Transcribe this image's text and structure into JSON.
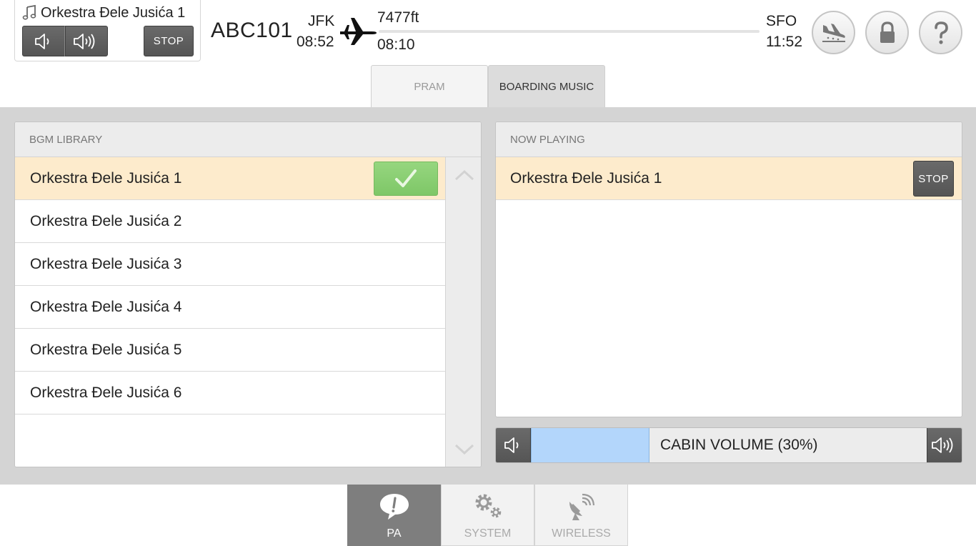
{
  "now_playing_widget": {
    "track": "Orkestra Đele Jusića 1",
    "music_icon": "music-note-icon",
    "vol_down_icon": "speaker-low-icon",
    "vol_up_icon": "speaker-high-icon",
    "stop_label": "STOP"
  },
  "flight": {
    "number": "ABC101",
    "origin": "JFK",
    "departure_time": "08:52",
    "altitude": "7477ft",
    "elapsed": "08:10",
    "destination": "SFO",
    "arrival_time": "11:52",
    "progress_fraction": 0.0,
    "plane_icon": "airplane-icon"
  },
  "header_buttons": [
    {
      "name": "landing-icon"
    },
    {
      "name": "lock-icon"
    },
    {
      "name": "help-icon"
    }
  ],
  "tabs": [
    {
      "label": "PRAM",
      "active": false
    },
    {
      "label": "BOARDING MUSIC",
      "active": true
    }
  ],
  "library": {
    "title": "BGM LIBRARY",
    "items": [
      {
        "label": "Orkestra Đele Jusića 1",
        "selected": true
      },
      {
        "label": "Orkestra Đele Jusića 2",
        "selected": false
      },
      {
        "label": "Orkestra Đele Jusića 3",
        "selected": false
      },
      {
        "label": "Orkestra Đele Jusića 4",
        "selected": false
      },
      {
        "label": "Orkestra Đele Jusića 5",
        "selected": false
      },
      {
        "label": "Orkestra Đele Jusića 6",
        "selected": false
      }
    ],
    "check_icon": "checkmark-icon",
    "scroll_up_icon": "chevron-up-icon",
    "scroll_down_icon": "chevron-down-icon"
  },
  "now_playing": {
    "title": "NOW PLAYING",
    "track": "Orkestra Đele Jusića 1",
    "stop_label": "STOP"
  },
  "cabin_volume": {
    "label": "CABIN VOLUME (30%)",
    "level_fraction": 0.3
  },
  "bottom_nav": [
    {
      "label": "PA",
      "icon": "speech-bubble-icon",
      "active": true
    },
    {
      "label": "SYSTEM",
      "icon": "gears-icon",
      "active": false
    },
    {
      "label": "WIRELESS",
      "icon": "satellite-dish-icon",
      "active": false
    }
  ],
  "colors": {
    "selected_row": "#fdebcc",
    "check_green": "#7ec767",
    "volume_fill": "#b3d6fb",
    "active_nav": "#7e7e7e"
  }
}
